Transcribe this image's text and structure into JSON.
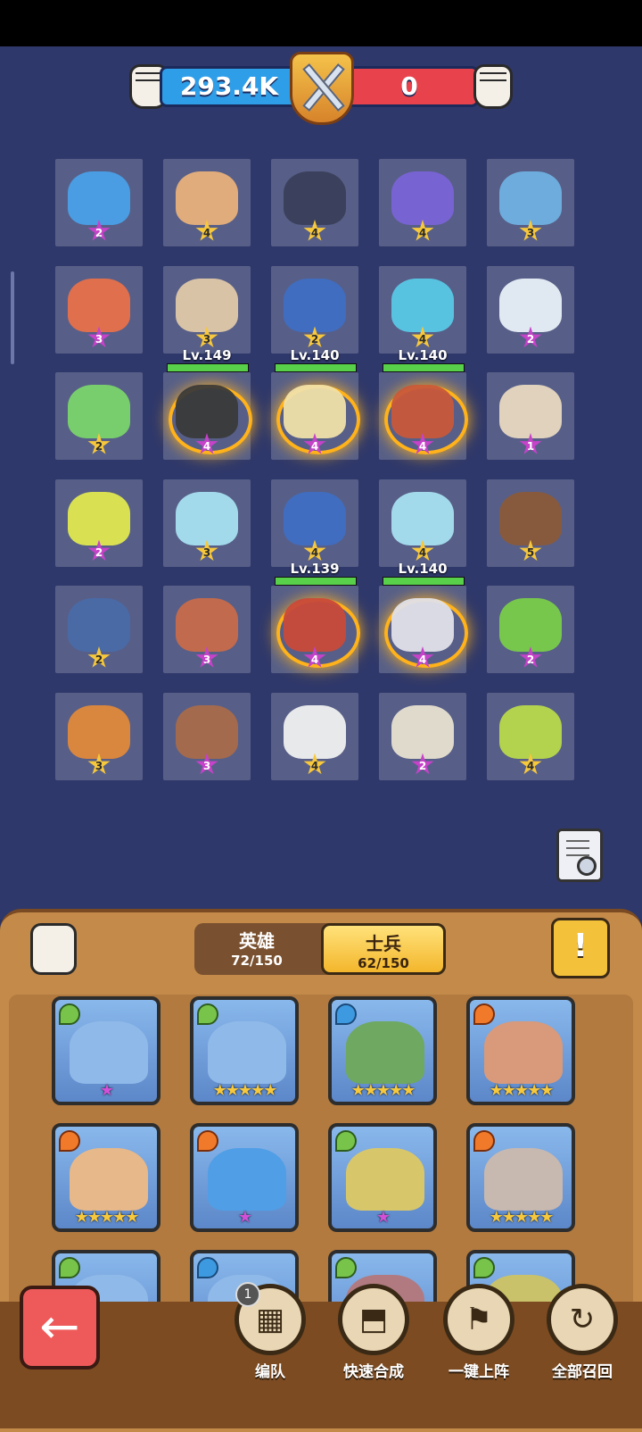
{
  "power": {
    "player": "293.4K",
    "enemy": "0"
  },
  "board": {
    "rows": [
      [
        {
          "stars": "2",
          "tier": "purple",
          "level": ""
        },
        {
          "stars": "4",
          "tier": "gold",
          "level": ""
        },
        {
          "stars": "4",
          "tier": "gold",
          "level": ""
        },
        {
          "stars": "4",
          "tier": "gold",
          "level": ""
        },
        {
          "stars": "3",
          "tier": "gold",
          "level": ""
        }
      ],
      [
        {
          "stars": "3",
          "tier": "purple",
          "level": ""
        },
        {
          "stars": "3",
          "tier": "gold",
          "level": ""
        },
        {
          "stars": "2",
          "tier": "gold",
          "level": ""
        },
        {
          "stars": "4",
          "tier": "gold",
          "level": ""
        },
        {
          "stars": "2",
          "tier": "purple",
          "level": ""
        }
      ],
      [
        {
          "stars": "2",
          "tier": "gold",
          "level": ""
        },
        {
          "stars": "4",
          "tier": "purple",
          "level": "Lv.149"
        },
        {
          "stars": "4",
          "tier": "purple",
          "level": "Lv.140"
        },
        {
          "stars": "4",
          "tier": "purple",
          "level": "Lv.140"
        },
        {
          "stars": "1",
          "tier": "purple",
          "level": ""
        }
      ],
      [
        {
          "stars": "2",
          "tier": "purple",
          "level": ""
        },
        {
          "stars": "3",
          "tier": "gold",
          "level": ""
        },
        {
          "stars": "4",
          "tier": "gold",
          "level": ""
        },
        {
          "stars": "4",
          "tier": "gold",
          "level": ""
        },
        {
          "stars": "5",
          "tier": "gold",
          "level": ""
        }
      ],
      [
        {
          "stars": "2",
          "tier": "gold",
          "level": ""
        },
        {
          "stars": "3",
          "tier": "purple",
          "level": ""
        },
        {
          "stars": "4",
          "tier": "purple",
          "level": "Lv.139"
        },
        {
          "stars": "4",
          "tier": "purple",
          "level": "Lv.140"
        },
        {
          "stars": "2",
          "tier": "purple",
          "level": ""
        }
      ],
      [
        {
          "stars": "3",
          "tier": "gold",
          "level": ""
        },
        {
          "stars": "3",
          "tier": "purple",
          "level": ""
        },
        {
          "stars": "4",
          "tier": "gold",
          "level": ""
        },
        {
          "stars": "2",
          "tier": "purple",
          "level": ""
        },
        {
          "stars": "4",
          "tier": "gold",
          "level": ""
        }
      ]
    ]
  },
  "tabs": {
    "hero": {
      "label": "英雄",
      "count": "72/150"
    },
    "soldier": {
      "label": "士兵",
      "count": "62/150"
    }
  },
  "warning_label": "!",
  "cards": [
    {
      "element": "leaf",
      "stars": "★",
      "tier": "purple",
      "color": "#8fb9e8"
    },
    {
      "element": "leaf",
      "stars": "★★★★★",
      "tier": "gold",
      "color": "#8fb9e8"
    },
    {
      "element": "water",
      "stars": "★★★★★",
      "tier": "gold",
      "color": "#6fa860"
    },
    {
      "element": "fire",
      "stars": "★★★★★",
      "tier": "gold",
      "color": "#d89a7a"
    },
    {
      "element": "fire",
      "stars": "★★★★★",
      "tier": "gold",
      "color": "#e7b889"
    },
    {
      "element": "fire",
      "stars": "★",
      "tier": "purple",
      "color": "#4f9ee6"
    },
    {
      "element": "leaf",
      "stars": "★",
      "tier": "purple",
      "color": "#d8c76a"
    },
    {
      "element": "fire",
      "stars": "★★★★★",
      "tier": "gold",
      "color": "#c7b8b0"
    },
    {
      "element": "leaf",
      "stars": "",
      "tier": "gold",
      "color": "#8fb9e8"
    },
    {
      "element": "water",
      "stars": "",
      "tier": "gold",
      "color": "#8fb9e8"
    },
    {
      "element": "leaf",
      "stars": "",
      "tier": "gold",
      "color": "#b07a80"
    },
    {
      "element": "leaf",
      "stars": "",
      "tier": "gold",
      "color": "#c9c26a"
    }
  ],
  "actions": {
    "back": "←",
    "formation": {
      "label": "编队",
      "badge": "1"
    },
    "quick_merge": {
      "label": "快速合成"
    },
    "deploy_all": {
      "label": "一键上阵"
    },
    "recall_all": {
      "label": "全部召回"
    }
  },
  "unit_colors": [
    [
      "#4aa0e8",
      "#e8b07a",
      "#3a3f5a",
      "#7a63d6",
      "#6fb0e0"
    ],
    [
      "#e8704a",
      "#e0c8a8",
      "#3f6ec2",
      "#58c8e6",
      "#e8f0f8"
    ],
    [
      "#7ad46a",
      "#3a3a3a",
      "#f0e0a8",
      "#c8583a",
      "#e8d8c0"
    ],
    [
      "#e0e850",
      "#a8e0f0",
      "#3f6ec2",
      "#a8e0f0",
      "#8a5a3a"
    ],
    [
      "#4a6aa8",
      "#c86a4a",
      "#c84a3a",
      "#e0e0e8",
      "#7acc4a"
    ],
    [
      "#e0883a",
      "#a86a4a",
      "#f0f0f0",
      "#e8e0d0",
      "#b8d84a"
    ]
  ]
}
